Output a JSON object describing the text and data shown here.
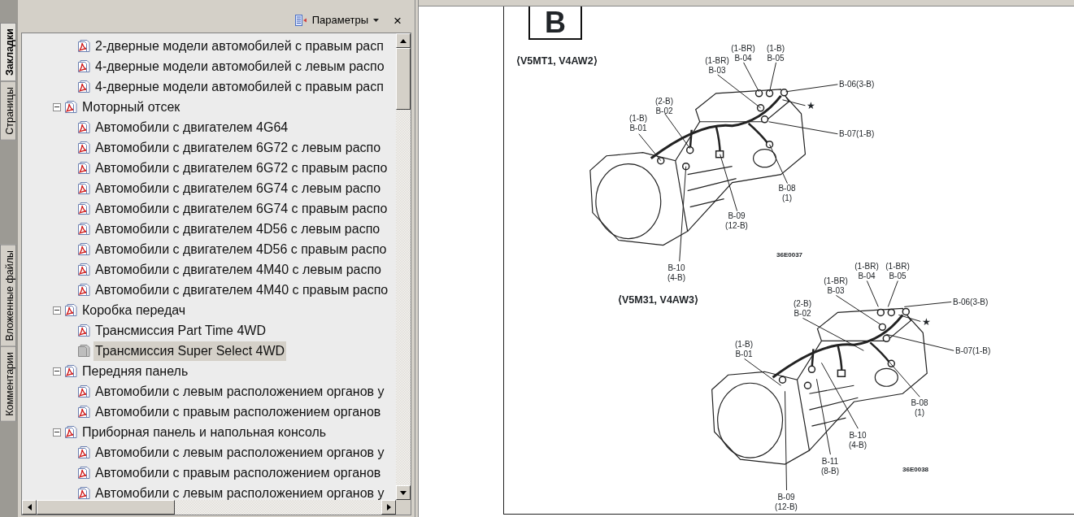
{
  "navigation_tabs": [
    {
      "label": "Закладки",
      "selected": true
    },
    {
      "label": "Страницы",
      "selected": false
    },
    {
      "label": "Вложенные файлы",
      "selected": false
    },
    {
      "label": "Комментарии",
      "selected": false
    }
  ],
  "panel": {
    "options_label": "Параметры",
    "close_glyph": "×",
    "tree_head": [
      {
        "label": "2-дверные модели автомобилей с правым расп",
        "selected": false
      },
      {
        "label": "4-дверные модели автомобилей с левым распо",
        "selected": false
      },
      {
        "label": "4-дверные модели автомобилей с правым расп",
        "selected": false
      }
    ],
    "tree": [
      {
        "label": "Моторный отсек",
        "expanded": true,
        "selected": false,
        "children": [
          {
            "label": "Автомобили с двигателем 4G64",
            "selected": false
          },
          {
            "label": "Автомобили с двигателем 6G72 с левым распо",
            "selected": false
          },
          {
            "label": "Автомобили с двигателем 6G72 с правым распо",
            "selected": false
          },
          {
            "label": "Автомобили с двигателем 6G74 с левым распо",
            "selected": false
          },
          {
            "label": "Автомобили с двигателем 6G74 с правым распо",
            "selected": false
          },
          {
            "label": "Автомобили с двигателем 4D56 с левым распо",
            "selected": false
          },
          {
            "label": "Автомобили с двигателем 4D56 с правым распо",
            "selected": false
          },
          {
            "label": "Автомобили с двигателем 4M40 с левым распо",
            "selected": false
          },
          {
            "label": "Автомобили с двигателем 4M40 с правым распо",
            "selected": false
          }
        ]
      },
      {
        "label": "Коробка передач",
        "expanded": true,
        "selected": false,
        "children": [
          {
            "label": "Трансмиссия Part Time 4WD",
            "selected": false
          },
          {
            "label": "Трансмиссия Super Select 4WD",
            "selected": true
          }
        ]
      },
      {
        "label": "Передняя панель",
        "expanded": true,
        "selected": false,
        "children": [
          {
            "label": "Автомобили с левым расположением органов у",
            "selected": false
          },
          {
            "label": "Автомобили с правым расположением органов",
            "selected": false
          }
        ]
      },
      {
        "label": "Приборная панель и напольная консоль",
        "expanded": true,
        "selected": false,
        "children": [
          {
            "label": "Автомобили с левым расположением органов у",
            "selected": false
          },
          {
            "label": "Автомобили с правым расположением органов",
            "selected": false
          },
          {
            "label": "Автомобили с левым расположением органов у",
            "selected": false
          }
        ]
      }
    ]
  },
  "page": {
    "section_letter": "B",
    "diagrams": [
      {
        "title": "⟨V5MT1, V4AW2⟩",
        "figure_code": "36E0037",
        "star": "★",
        "labels": [
          {
            "lines": [
              "(1-B)",
              "B-01"
            ]
          },
          {
            "lines": [
              "(2-B)",
              "B-02"
            ]
          },
          {
            "lines": [
              "(1-BR)",
              "B-03"
            ]
          },
          {
            "lines": [
              "(1-BR)",
              "B-04"
            ]
          },
          {
            "lines": [
              "(1-B)",
              "B-05"
            ]
          },
          {
            "lines": [
              "B-06(3-B)"
            ]
          },
          {
            "lines": [
              "B-07(1-B)"
            ]
          },
          {
            "lines": [
              "B-08",
              "(1)"
            ]
          },
          {
            "lines": [
              "B-09",
              "(12-B)"
            ]
          },
          {
            "lines": [
              "B-10",
              "(4-B)"
            ]
          }
        ]
      },
      {
        "title": "⟨V5M31, V4AW3⟩",
        "figure_code": "36E0038",
        "star": "★",
        "labels": [
          {
            "lines": [
              "(1-B)",
              "B-01"
            ]
          },
          {
            "lines": [
              "(2-B)",
              "B-02"
            ]
          },
          {
            "lines": [
              "(1-BR)",
              "B-03"
            ]
          },
          {
            "lines": [
              "(1-BR)",
              "B-04"
            ]
          },
          {
            "lines": [
              "(1-BR)",
              "B-05"
            ]
          },
          {
            "lines": [
              "B-06(3-B)"
            ]
          },
          {
            "lines": [
              "B-07(1-B)"
            ]
          },
          {
            "lines": [
              "B-08",
              "(1)"
            ]
          },
          {
            "lines": [
              "B-09",
              "(12-B)"
            ]
          },
          {
            "lines": [
              "B-10",
              "(4-B)"
            ]
          },
          {
            "lines": [
              "B-11",
              "(8-B)"
            ]
          }
        ]
      }
    ]
  }
}
